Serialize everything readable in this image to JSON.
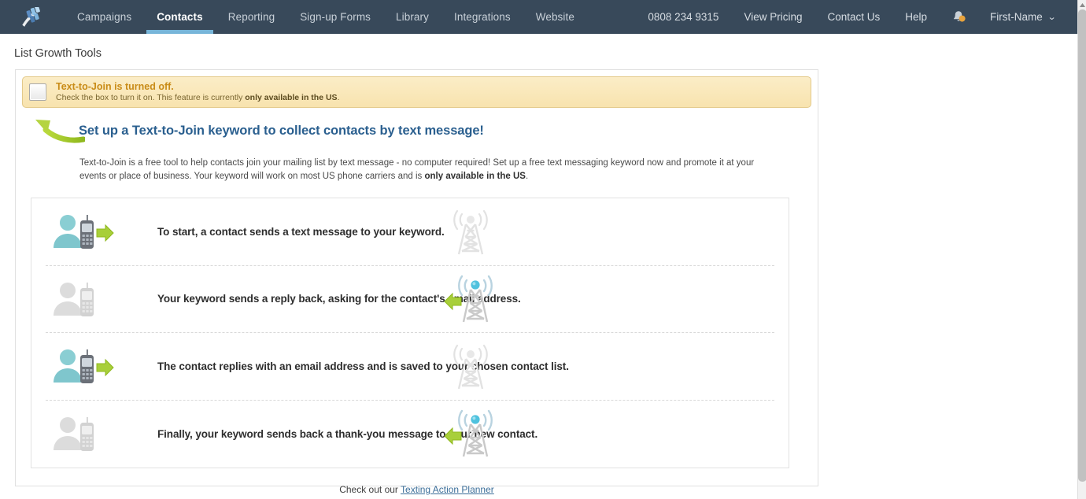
{
  "nav": {
    "logo_icon": "verticalresponse-logo-icon",
    "left_items": [
      {
        "label": "Campaigns",
        "active": false
      },
      {
        "label": "Contacts",
        "active": true
      },
      {
        "label": "Reporting",
        "active": false
      },
      {
        "label": "Sign-up Forms",
        "active": false
      },
      {
        "label": "Library",
        "active": false
      },
      {
        "label": "Integrations",
        "active": false
      },
      {
        "label": "Website",
        "active": false
      }
    ],
    "right_items": [
      {
        "label": "0808 234 9315"
      },
      {
        "label": "View Pricing"
      },
      {
        "label": "Contact Us"
      },
      {
        "label": "Help"
      }
    ],
    "bell_icon": "bell-icon",
    "bell_badge_color": "#e8a33d",
    "account_label": "First-Name",
    "account_caret": "⌄",
    "bar_color": "#38495a",
    "active_underline_color": "#77b5d9"
  },
  "page": {
    "title": "List Growth Tools"
  },
  "alert": {
    "title": "Text-to-Join is turned off.",
    "sub_prefix": "Check the box to turn it on. This feature is currently ",
    "sub_bold": "only available in the US",
    "sub_suffix": ".",
    "checkbox_checked": false,
    "background_color": "#f9e7b6",
    "border_color": "#e3c98a",
    "title_color": "#c98c18"
  },
  "hero": {
    "arrow_icon": "curved-green-arrow-icon",
    "arrow_color": "#a6ce2e",
    "headline": "Set up a Text-to-Join keyword to collect contacts by text message!",
    "headline_color": "#2a5f8f",
    "paragraph_part1": "Text-to-Join is a free tool to help contacts join your mailing list by text message - no computer required! Set up a free text messaging keyword now and promote it at your events or place of business. Your keyword will work on most US phone carriers and is ",
    "paragraph_bold": "only available in the US",
    "paragraph_part2": "."
  },
  "steps": [
    {
      "text": "To start, a contact sends a text message to your keyword.",
      "person_icon": "person-with-phone-active-icon",
      "person_state": "active",
      "arrow_icon": "green-right-arrow-icon",
      "arrow_direction": "right",
      "tower_icon": "cell-tower-inactive-icon",
      "tower_state": "inactive"
    },
    {
      "text": "Your keyword sends a reply back, asking for the contact's email address.",
      "person_icon": "person-with-phone-inactive-icon",
      "person_state": "inactive",
      "arrow_icon": "green-left-arrow-icon",
      "arrow_direction": "left",
      "tower_icon": "cell-tower-active-icon",
      "tower_state": "active"
    },
    {
      "text": "The contact replies with an email address and is saved to your chosen contact list.",
      "person_icon": "person-with-phone-active-icon",
      "person_state": "active",
      "arrow_icon": "green-right-arrow-icon",
      "arrow_direction": "right",
      "tower_icon": "cell-tower-inactive-icon",
      "tower_state": "inactive"
    },
    {
      "text": "Finally, your keyword sends back a thank-you message to your new contact.",
      "person_icon": "person-with-phone-inactive-icon",
      "person_state": "inactive",
      "arrow_icon": "green-left-arrow-icon",
      "arrow_direction": "left",
      "tower_icon": "cell-tower-active-icon",
      "tower_state": "active"
    }
  ],
  "footer": {
    "prefix": "Check out our ",
    "link_label": "Texting Action Planner",
    "link_color": "#3b6e99"
  },
  "scrollbar": {
    "up_arrow_icon": "scroll-up-arrow-icon",
    "thumb_color": "#c1c1c1"
  }
}
